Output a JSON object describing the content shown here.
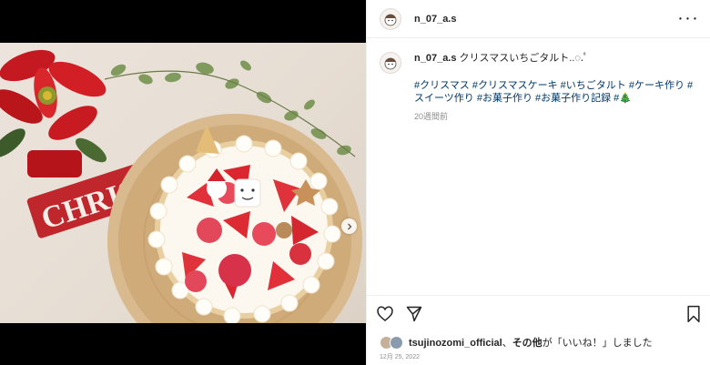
{
  "post": {
    "username": "n_07_a.s",
    "more_label": "･･･",
    "caption_user": "n_07_a.s",
    "caption_text": " クリスマスいちごタルト..◌.ﾟ",
    "hashtags": "#クリスマス #クリスマスケーキ #いちごタルト #ケーキ作り #スイーツ作り #お菓子作り #お菓子作り記録 #🎄",
    "time_ago": "20週間前",
    "likes_user": "tsujinozomi_official",
    "likes_sep": "、",
    "likes_others": "その他",
    "likes_suffix": "が「いいね！」しました",
    "date": "12月 25, 2022"
  },
  "image": {
    "sign_text": "CHRISTMAS",
    "carousel_dots": 2,
    "active_dot": 0
  },
  "icons": {
    "like": "heart-icon",
    "share": "paper-plane-icon",
    "save": "bookmark-icon",
    "next": "chevron-right-icon",
    "more": "more-options-icon"
  },
  "colors": {
    "link": "#00376b",
    "muted": "#8e8e8e",
    "active_dot": "#3897f0"
  }
}
